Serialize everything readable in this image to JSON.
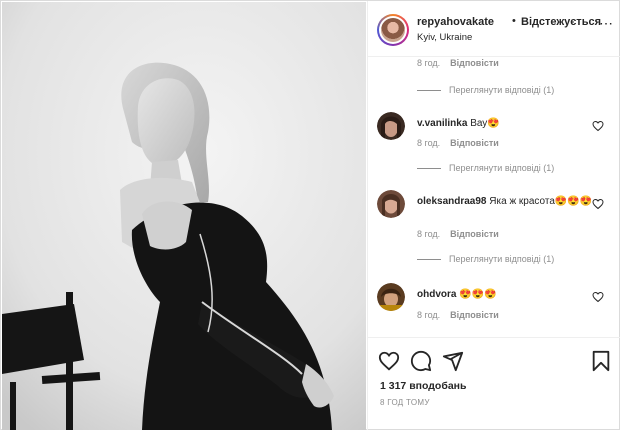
{
  "header": {
    "username": "repyahovakate",
    "separator": "•",
    "follow_label": "Відстежується",
    "location": "Kyiv, Ukraine",
    "more_icon": "ellipsis-icon"
  },
  "comments": {
    "top_meta": {
      "time": "8 год.",
      "reply": "Відповісти"
    },
    "top_view_replies": "Переглянути відповіді (1)",
    "items": [
      {
        "user": "v.vanilinka",
        "text": "Вау😍",
        "time": "8 год.",
        "reply": "Відповісти",
        "view_replies": "Переглянути відповіді (1)"
      },
      {
        "user": "oleksandraa98",
        "text": "Яка ж красота😍😍😍",
        "time": "8 год.",
        "reply": "Відповісти",
        "view_replies": "Переглянути відповіді (1)"
      },
      {
        "user": "ohdvora",
        "text": "😍😍😍",
        "time": "8 год.",
        "reply": "Відповісти"
      }
    ]
  },
  "actions": {
    "like_icon": "heart-icon",
    "comment_icon": "comment-icon",
    "share_icon": "send-icon",
    "save_icon": "bookmark-icon",
    "likes": "1 317 вподобань",
    "posted": "8 ГОД ТОМУ"
  }
}
